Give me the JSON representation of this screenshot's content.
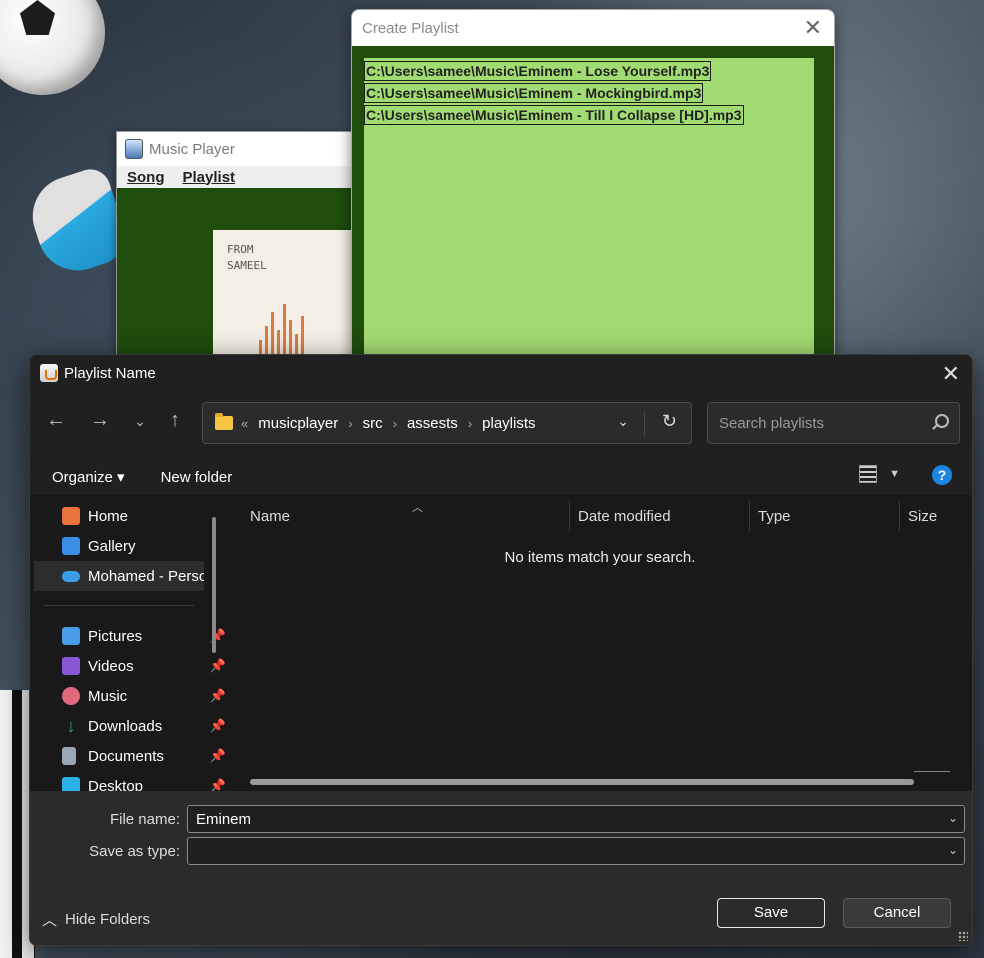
{
  "music_player": {
    "title": "Music Player",
    "menu": [
      "Song",
      "Playlist"
    ],
    "album_text": "FROM\nSAMEEL"
  },
  "create_playlist": {
    "title": "Create Playlist",
    "files": [
      "C:\\Users\\samee\\Music\\Eminem - Lose Yourself.mp3",
      "C:\\Users\\samee\\Music\\Eminem - Mockingbird.mp3",
      "C:\\Users\\samee\\Music\\Eminem - Till I Collapse [HD].mp3"
    ]
  },
  "dialog": {
    "title": "Playlist Name",
    "breadcrumb": [
      "«",
      "musicplayer",
      "src",
      "assests",
      "playlists"
    ],
    "search_placeholder": "Search playlists",
    "toolbar": {
      "organize": "Organize ▾",
      "new_folder": "New folder"
    },
    "sidebar": [
      {
        "label": "Home",
        "icon": "home-icon",
        "color": "#e8743b"
      },
      {
        "label": "Gallery",
        "icon": "gallery-icon",
        "color": "#3a8ee6"
      },
      {
        "label": "Mohamed - Perso",
        "icon": "onedrive-icon",
        "color": "#3a9be6",
        "selected": true
      },
      {
        "label": "Pictures",
        "icon": "pictures-icon",
        "color": "#4a9be8",
        "pinned": true
      },
      {
        "label": "Videos",
        "icon": "videos-icon",
        "color": "#8a56d8",
        "pinned": true
      },
      {
        "label": "Music",
        "icon": "music-icon",
        "color": "#e06a7a",
        "pinned": true
      },
      {
        "label": "Downloads",
        "icon": "downloads-icon",
        "color": "#2ba86a",
        "pinned": true
      },
      {
        "label": "Documents",
        "icon": "documents-icon",
        "color": "#9aa7b8",
        "pinned": true
      },
      {
        "label": "Desktop",
        "icon": "desktop-icon",
        "color": "#2bb0e8",
        "pinned": true
      }
    ],
    "columns": [
      "Name",
      "Date modified",
      "Type",
      "Size"
    ],
    "empty_message": "No items match your search.",
    "file_name_label": "File name:",
    "file_name_value": "Eminem",
    "save_type_label": "Save as type:",
    "save_type_value": "",
    "hide_folders": "Hide Folders",
    "save_button": "Save",
    "cancel_button": "Cancel"
  }
}
